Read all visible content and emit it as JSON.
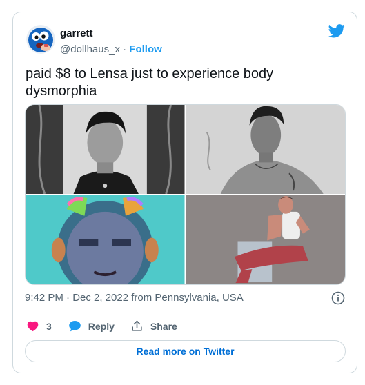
{
  "tweet": {
    "author_name": "garrett",
    "handle": "@dollhaus_x",
    "separator": "·",
    "follow_label": "Follow",
    "text": "paid $8 to Lensa just to experience body dysmorphia",
    "timestamp": "9:42 PM · Dec 2, 2022 from Pennsylvania, USA",
    "likes_count": "3",
    "reply_label": "Reply",
    "share_label": "Share",
    "read_more_label": "Read more on Twitter"
  },
  "colors": {
    "twitter_blue": "#1d9bf0",
    "like_red": "#f91880",
    "border": "#cfd9de",
    "secondary_text": "#536471"
  },
  "icons": [
    "twitter-bird-icon",
    "info-icon",
    "heart-icon",
    "reply-bubble-icon",
    "share-icon"
  ]
}
